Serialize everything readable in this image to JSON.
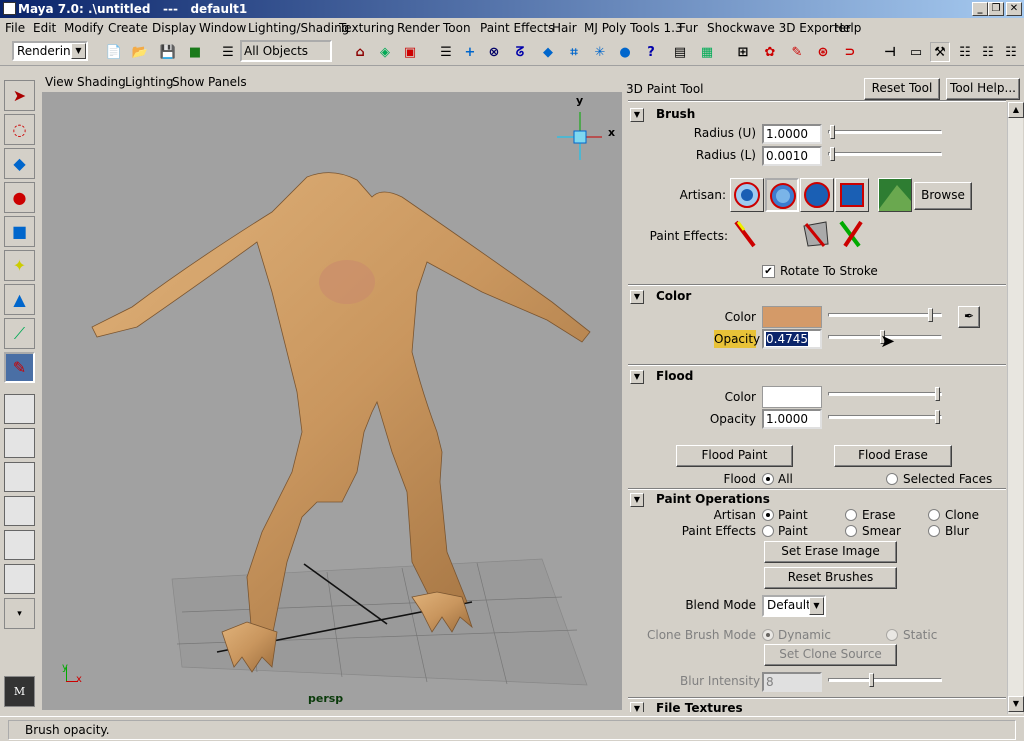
{
  "window": {
    "title": "Maya 7.0: .\\untitled   ---   default1",
    "minimize": "_",
    "restore": "❐",
    "close": "✕"
  },
  "menubar": [
    "File",
    "Edit",
    "Modify",
    "Create",
    "Display",
    "Window",
    "Lighting/Shading",
    "Texturing",
    "Render",
    "Toon",
    "Paint Effects",
    "Hair",
    "MJ Poly Tools 1.3",
    "Fur",
    "Shockwave 3D Exporter",
    "Help"
  ],
  "shelf": {
    "menu_set": "Rendering",
    "selection_field": "All Objects"
  },
  "viewport": {
    "menu": [
      "View",
      "Shading",
      "Lighting",
      "Show",
      "Panels"
    ],
    "camera_label": "persp",
    "axis_y": "y",
    "axis_x": "x"
  },
  "panel": {
    "title": "3D Paint Tool",
    "reset_button": "Reset Tool",
    "help_button": "Tool Help...",
    "brush": {
      "header": "Brush",
      "radius_u_label": "Radius (U)",
      "radius_u": "1.0000",
      "radius_l_label": "Radius (L)",
      "radius_l": "0.0010",
      "artisan_label": "Artisan:",
      "browse": "Browse",
      "paint_effects_label": "Paint Effects:",
      "rotate_to_stroke": "Rotate To Stroke",
      "rotate_checked": true
    },
    "color": {
      "header": "Color",
      "color_label": "Color",
      "swatch": "#d49a68",
      "opacity_label": "Opacity",
      "opacity": "0.4745",
      "color_slider": 0.92,
      "opacity_slider": 0.4745
    },
    "flood": {
      "header": "Flood",
      "color_label": "Color",
      "swatch": "#ffffff",
      "opacity_label": "Opacity",
      "opacity": "1.0000",
      "flood_paint": "Flood Paint",
      "flood_erase": "Flood Erase",
      "flood_label": "Flood",
      "all": "All",
      "selected_faces": "Selected Faces"
    },
    "ops": {
      "header": "Paint Operations",
      "artisan_label": "Artisan",
      "paint": "Paint",
      "erase": "Erase",
      "clone": "Clone",
      "pe_label": "Paint Effects",
      "smear": "Smear",
      "blur": "Blur",
      "set_erase_image": "Set Erase Image",
      "reset_brushes": "Reset Brushes",
      "blend_mode_label": "Blend Mode",
      "blend_mode": "Default",
      "clone_mode_label": "Clone Brush Mode",
      "dynamic": "Dynamic",
      "static": "Static",
      "set_clone_source": "Set Clone Source",
      "blur_intensity_label": "Blur Intensity",
      "blur_intensity": "8"
    },
    "file_textures": {
      "header": "File Textures"
    }
  },
  "status": {
    "text": "Brush opacity."
  },
  "colors": {
    "viewport_bg": "#a1a1a1",
    "ui_bg": "#d4d0c8",
    "title_blue": "#0a246a",
    "highlight": "#e8c238",
    "field_select": "#0a246a"
  }
}
